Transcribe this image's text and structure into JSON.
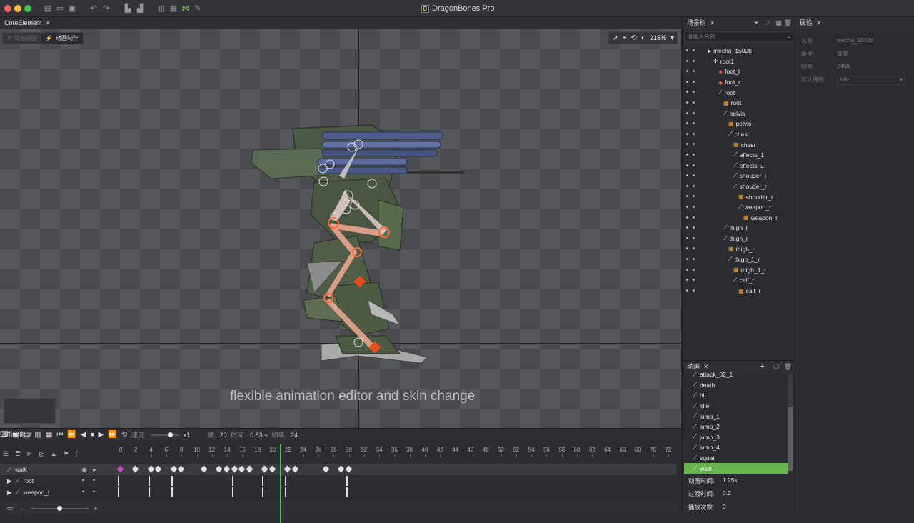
{
  "app": {
    "title": "DragonBones Pro"
  },
  "doc_tab": {
    "label": "CoreElement"
  },
  "mode": {
    "armature": "骨骼装配",
    "animate": "动画制作"
  },
  "viewport": {
    "zoom": "215%",
    "caption": "flexible animation editor and skin change"
  },
  "timeline": {
    "tab": "时间轴",
    "speed_label": "速度:",
    "speed_value": "x1",
    "frame_label": "帧:",
    "frame_value": "20",
    "time_label": "时间:",
    "time_value": "0.83 s",
    "fps_label": "帧率:",
    "fps_value": "24",
    "ruler": [
      "0",
      "2",
      "4",
      "6",
      "8",
      "10",
      "12",
      "14",
      "16",
      "18",
      "20",
      "22",
      "24",
      "26",
      "28",
      "30",
      "32",
      "34",
      "36",
      "38",
      "40",
      "42",
      "44",
      "46",
      "48",
      "50",
      "52",
      "54",
      "56",
      "58",
      "60",
      "62",
      "64",
      "66",
      "68",
      "70",
      "72"
    ],
    "tracks": [
      {
        "name": "walk"
      },
      {
        "name": "root"
      },
      {
        "name": "weapon_l"
      }
    ]
  },
  "scene_tree": {
    "tab": "场景树",
    "search_placeholder": "请输入名称",
    "items": [
      {
        "label": "mecha_1502b",
        "icon": "armature-icon"
      },
      {
        "label": "root1",
        "icon": "cross-icon"
      },
      {
        "label": "foot_l",
        "icon": "ik-icon"
      },
      {
        "label": "foot_r",
        "icon": "ik-icon"
      },
      {
        "label": "root",
        "icon": "bone-icon"
      },
      {
        "label": "root",
        "icon": "slot-icon"
      },
      {
        "label": "pelvis",
        "icon": "bone-icon"
      },
      {
        "label": "pelvis",
        "icon": "slot-icon"
      },
      {
        "label": "chest",
        "icon": "bone-icon"
      },
      {
        "label": "chest",
        "icon": "slot-icon"
      },
      {
        "label": "effects_1",
        "icon": "bone-icon"
      },
      {
        "label": "effects_2",
        "icon": "bone-icon"
      },
      {
        "label": "shouder_l",
        "icon": "bone-icon"
      },
      {
        "label": "shouder_r",
        "icon": "bone-icon"
      },
      {
        "label": "shouder_r",
        "icon": "slot-icon"
      },
      {
        "label": "weapon_r",
        "icon": "bone-icon"
      },
      {
        "label": "weapon_r",
        "icon": "slot-icon"
      },
      {
        "label": "thigh_l",
        "icon": "bone-icon"
      },
      {
        "label": "thigh_r",
        "icon": "bone-icon"
      },
      {
        "label": "thigh_r",
        "icon": "slot-icon"
      },
      {
        "label": "thigh_1_r",
        "icon": "bone-icon"
      },
      {
        "label": "thigh_1_r",
        "icon": "slot-icon"
      },
      {
        "label": "calf_r",
        "icon": "bone-icon"
      },
      {
        "label": "calf_r",
        "icon": "slot-icon"
      }
    ]
  },
  "properties": {
    "tab": "属性",
    "fields": [
      {
        "label": "名称:",
        "value": "mecha_1502b"
      },
      {
        "label": "类型:",
        "value": "骨架"
      },
      {
        "label": "帧率:",
        "value": "24fps"
      },
      {
        "label": "默认播放:",
        "value": "idle"
      }
    ]
  },
  "animations": {
    "tab": "动画",
    "items": [
      "attack_02_1",
      "death",
      "hit",
      "idle",
      "jump_1",
      "jump_2",
      "jump_3",
      "jump_4",
      "squat",
      "walk"
    ],
    "selected": "walk",
    "duration_label": "动画时间:",
    "duration_value": "1.25s",
    "fade_label": "过渡时间:",
    "fade_value": "0.2",
    "play_label": "播放次数:",
    "play_value": "0"
  }
}
